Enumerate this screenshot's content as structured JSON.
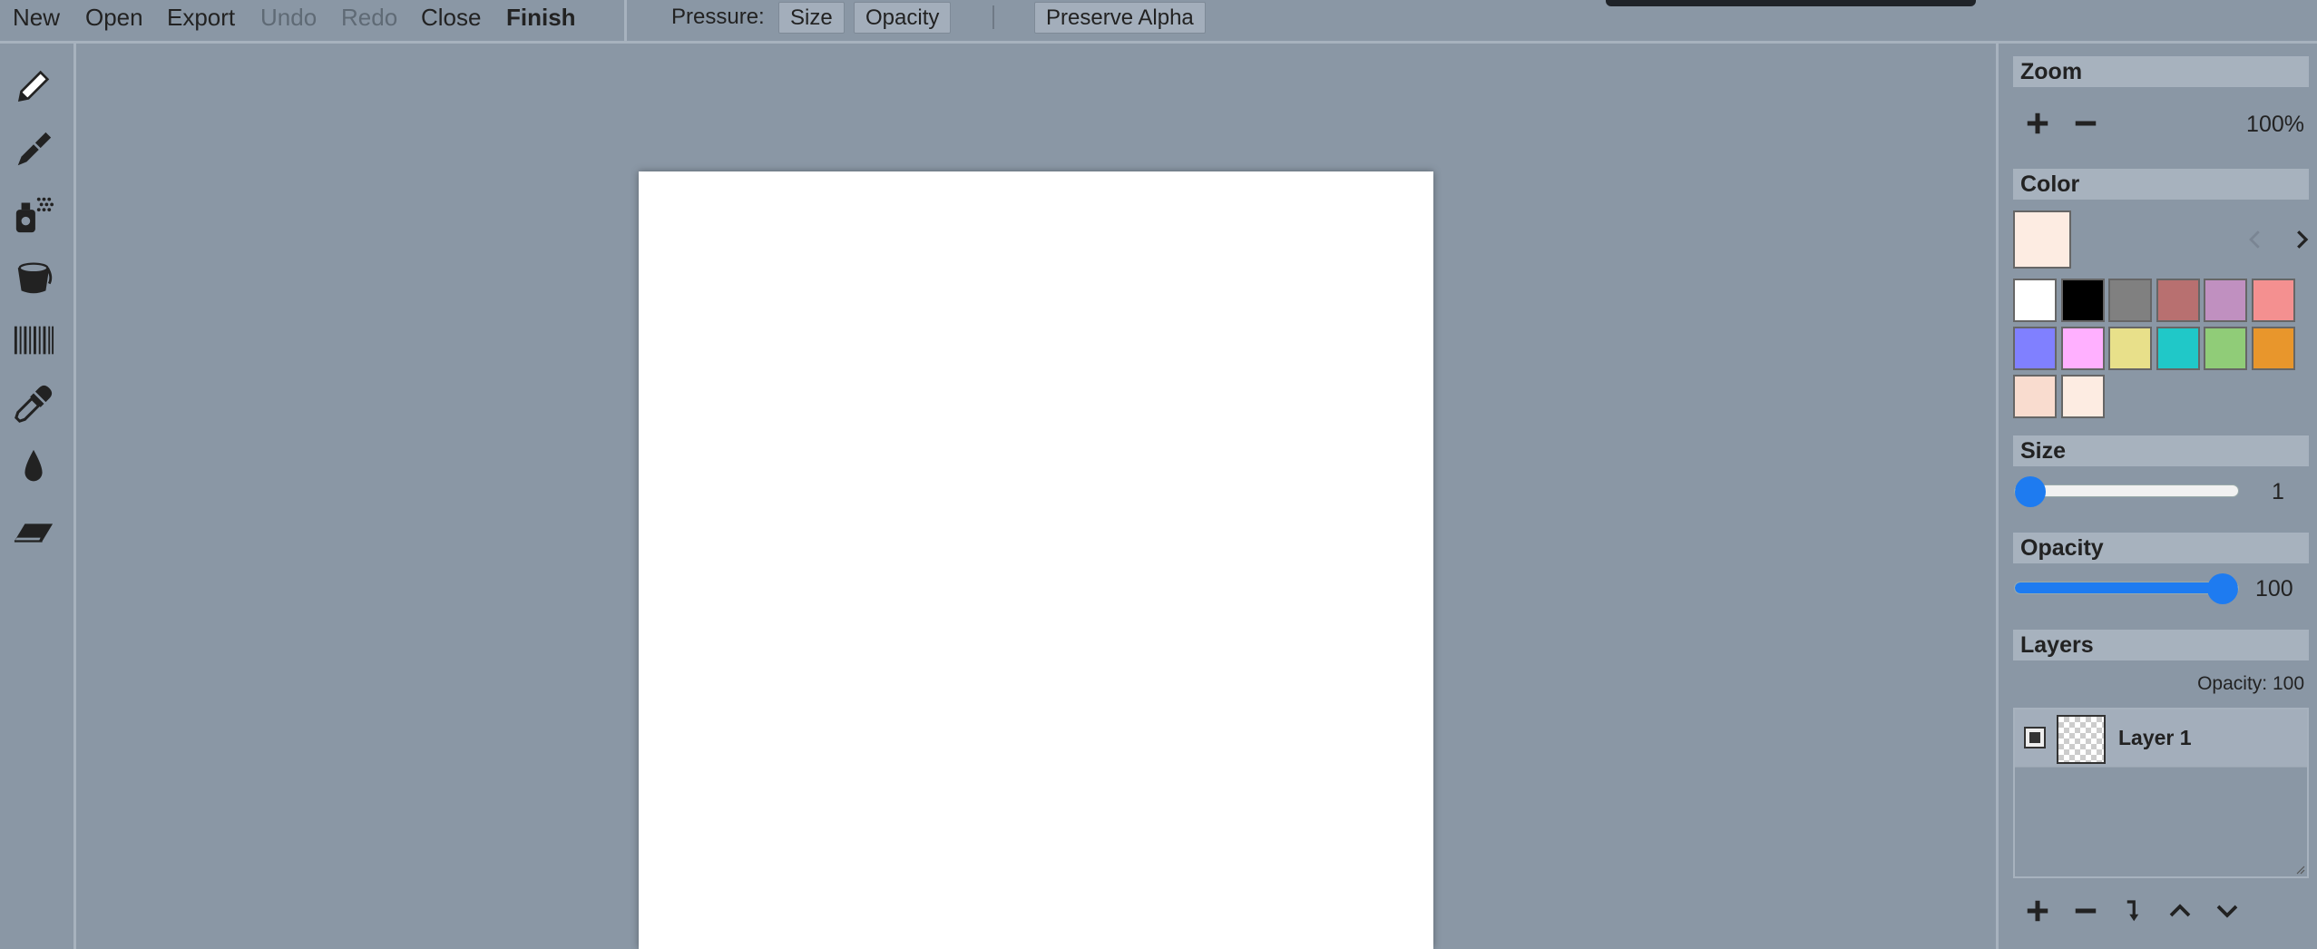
{
  "menu": {
    "new": "New",
    "open": "Open",
    "export": "Export",
    "undo": "Undo",
    "redo": "Redo",
    "close": "Close",
    "finish": "Finish"
  },
  "toolbar": {
    "pressure_label": "Pressure:",
    "size": "Size",
    "opacity": "Opacity",
    "preserve_alpha": "Preserve Alpha"
  },
  "tools": [
    "pencil-icon",
    "pen-brush-icon",
    "spray-can-icon",
    "paint-bucket-icon",
    "pattern-lines-icon",
    "eyedropper-icon",
    "blur-drop-icon",
    "eraser-icon"
  ],
  "zoom": {
    "title": "Zoom",
    "value": "100%"
  },
  "color": {
    "title": "Color",
    "current": "#fdece2",
    "swatches": [
      "#ffffff",
      "#000000",
      "#808080",
      "#b87070",
      "#c090c0",
      "#f49090",
      "#8080ff",
      "#ffb0ff",
      "#e8e08a",
      "#20c8c8",
      "#90cc78",
      "#e8962c",
      "#f9dccf",
      "#fdece2"
    ]
  },
  "size": {
    "title": "Size",
    "value": "1",
    "level": 0.0
  },
  "opacity": {
    "title": "Opacity",
    "value": "100",
    "level": 1.0
  },
  "layers": {
    "title": "Layers",
    "opacity_label": "Opacity: 100",
    "items": [
      {
        "name": "Layer 1",
        "visible": true
      }
    ]
  },
  "accent": "#1e7bf0"
}
